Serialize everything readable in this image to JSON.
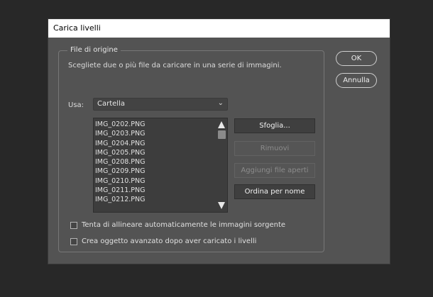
{
  "dialog": {
    "title": "Carica livelli",
    "group_title": "File di origine",
    "instructions": "Scegliete due o più file da caricare in una serie di immagini.",
    "usa_label": "Usa:",
    "usa_value": "Cartella",
    "files": [
      "IMG_0202.PNG",
      "IMG_0203.PNG",
      "IMG_0204.PNG",
      "IMG_0205.PNG",
      "IMG_0208.PNG",
      "IMG_0209.PNG",
      "IMG_0210.PNG",
      "IMG_0211.PNG",
      "IMG_0212.PNG"
    ],
    "buttons": {
      "browse": "Sfoglia...",
      "remove": "Rimuovi",
      "add_open": "Aggiungi file aperti",
      "sort_name": "Ordina per nome",
      "ok": "OK",
      "cancel": "Annulla"
    },
    "checkboxes": {
      "auto_align": "Tenta di allineare automaticamente le immagini sorgente",
      "smart_object": "Crea oggetto avanzato dopo aver caricato i livelli"
    }
  }
}
